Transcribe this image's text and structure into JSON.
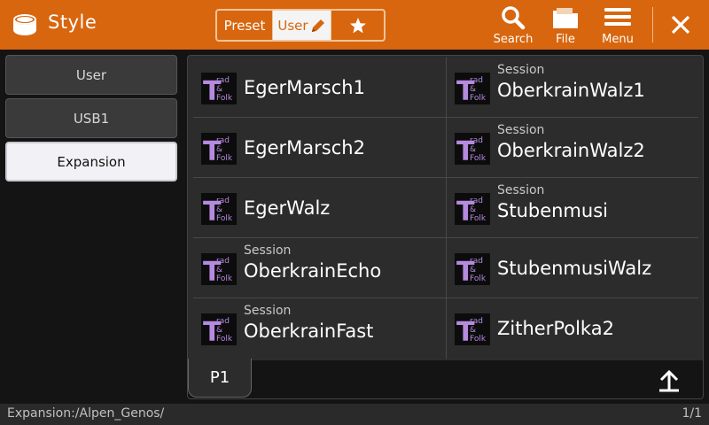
{
  "header": {
    "title": "Style",
    "tabs": {
      "preset": "Preset",
      "user": "User",
      "favorite_icon": "star-icon"
    },
    "buttons": {
      "search": "Search",
      "file": "File",
      "menu": "Menu"
    },
    "colors": {
      "bar": "#d8660e",
      "tab_border": "#f3c49a"
    }
  },
  "sidebar": {
    "items": [
      {
        "label": "User"
      },
      {
        "label": "USB1"
      },
      {
        "label": "Expansion"
      }
    ],
    "selected": "Expansion"
  },
  "styles": [
    {
      "name": "EgerMarsch1",
      "subtitle": ""
    },
    {
      "name": "OberkrainWalz1",
      "subtitle": "Session"
    },
    {
      "name": "EgerMarsch2",
      "subtitle": ""
    },
    {
      "name": "OberkrainWalz2",
      "subtitle": "Session"
    },
    {
      "name": "EgerWalz",
      "subtitle": ""
    },
    {
      "name": "Stubenmusi",
      "subtitle": "Session"
    },
    {
      "name": "OberkrainEcho",
      "subtitle": "Session"
    },
    {
      "name": "StubenmusiWalz",
      "subtitle": ""
    },
    {
      "name": "OberkrainFast",
      "subtitle": "Session"
    },
    {
      "name": "ZitherPolka2",
      "subtitle": ""
    }
  ],
  "style_icon": {
    "line1": "rad",
    "line2": "&",
    "line3": "Folk",
    "initial": "T",
    "color": "#b58adf"
  },
  "pager": {
    "page_label": "P1"
  },
  "status": {
    "path": "Expansion:/Alpen_Genos/",
    "page_count": "1/1"
  }
}
